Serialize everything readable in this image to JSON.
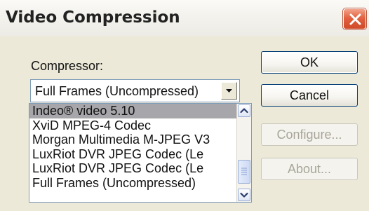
{
  "window": {
    "title": "Video Compression"
  },
  "labels": {
    "compressor": "Compressor:"
  },
  "compressor_select": {
    "selected": "Full Frames (Uncompressed)"
  },
  "compressor_list": {
    "items": [
      "Indeo® video 5.10",
      "XviD MPEG-4 Codec",
      "Morgan Multimedia M-JPEG V3",
      "LuxRiot DVR JPEG Codec (Le",
      "LuxRiot DVR JPEG Codec (Le",
      "Full Frames (Uncompressed)"
    ],
    "highlighted_index": 0
  },
  "buttons": {
    "ok": "OK",
    "cancel": "Cancel",
    "configure": "Configure...",
    "about": "About..."
  },
  "colors": {
    "close_button": "#e2613f",
    "selection": "#a7a6aa",
    "focus_border": "#003c74"
  }
}
